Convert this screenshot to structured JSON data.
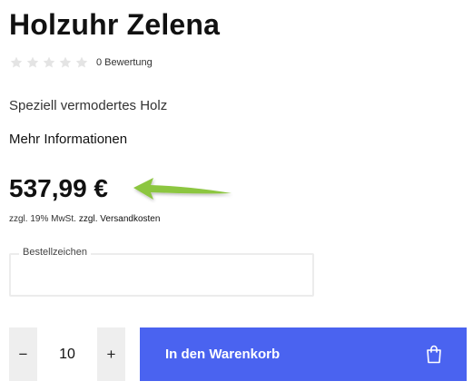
{
  "product": {
    "title": "Holzuhr Zelena",
    "rating_count_label": "0 Bewertung",
    "rating_value": 0,
    "rating_max": 5,
    "subtitle": "Speziell vermodertes Holz",
    "more_info_label": "Mehr Informationen",
    "price": "537,99 €",
    "tax_note": "zzgl. 19% MwSt.",
    "shipping_link": "zzgl. Versandkosten"
  },
  "order_field": {
    "label": "Bestellzeichen",
    "value": ""
  },
  "quantity": {
    "minus_label": "−",
    "value": "10",
    "plus_label": "+"
  },
  "cart": {
    "label": "In den Warenkorb",
    "icon": "shopping-bag-icon"
  },
  "colors": {
    "cart_button": "#4a63f0",
    "arrow": "#8cc63f",
    "star_empty": "#e4e4e4"
  },
  "annotation": {
    "arrow_color": "#8cc63f"
  }
}
